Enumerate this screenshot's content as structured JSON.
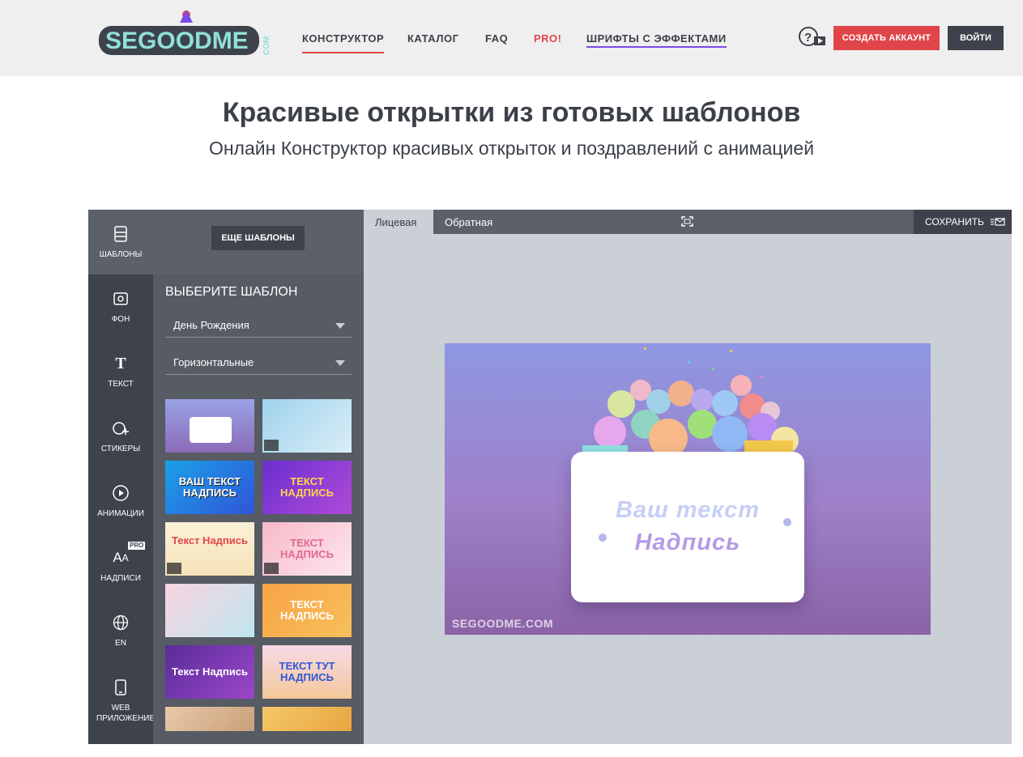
{
  "header": {
    "logo_text": "SEGOODME",
    "logo_suffix": "COM",
    "nav": [
      {
        "label": "КОНСТРУКТОР"
      },
      {
        "label": "КАТАЛОГ"
      },
      {
        "label": "FAQ"
      },
      {
        "label": "PRO!"
      },
      {
        "label": "ШРИФТЫ С ЭФФЕКТАМИ"
      }
    ],
    "help_icon": "help-video-icon",
    "create_account": "СОЗДАТЬ АККАУНТ",
    "login": "ВОЙТИ"
  },
  "hero": {
    "title": "Красивые открытки из готовых шаблонов",
    "subtitle": "Онлайн Конструктор красивых открыток и поздравлений с анимацией"
  },
  "toolbar": {
    "items": [
      {
        "label": "ШАБЛОНЫ",
        "icon": "templates-icon",
        "active": true
      },
      {
        "label": "ФОН",
        "icon": "background-icon"
      },
      {
        "label": "ТЕКСТ",
        "icon": "text-icon"
      },
      {
        "label": "СТИКЕРЫ",
        "icon": "sticker-icon"
      },
      {
        "label": "АНИМАЦИИ",
        "icon": "play-icon"
      },
      {
        "label": "НАДПИСИ",
        "icon": "font-icon",
        "badge": "PRO"
      },
      {
        "label": "EN",
        "icon": "globe-icon"
      },
      {
        "label": "WEB ПРИЛОЖЕНИЕ",
        "icon": "phone-icon"
      }
    ]
  },
  "panel": {
    "more_templates": "ЕЩЕ ШАБЛОНЫ",
    "heading": "ВЫБЕРИТЕ ШАБЛОН",
    "category": "День Рождения",
    "orientation": "Горизонтальные",
    "thumbs": [
      {
        "text": ""
      },
      {
        "text": ""
      },
      {
        "text": "ВАШ ТЕКСТ НАДПИСЬ"
      },
      {
        "text": "ТЕКСТ НАДПИСЬ"
      },
      {
        "text": "Текст Надпись"
      },
      {
        "text": "ТЕКСТ НАДПИСЬ"
      },
      {
        "text": ""
      },
      {
        "text": "ТЕКСТ НАДПИСЬ"
      },
      {
        "text": "Текст Надпись"
      },
      {
        "text": "ТЕКСТ ТУТ НАДПИСЬ"
      },
      {
        "text": ""
      },
      {
        "text": ""
      }
    ]
  },
  "canvas": {
    "tab_front": "Лицевая",
    "tab_back": "Обратная",
    "save": "СОХРАНИТЬ",
    "card_line1": "Ваш текст",
    "card_line2": "Надпись",
    "watermark": "SEGOODME.COM"
  },
  "colors": {
    "accent": "#e0454a",
    "dark": "#3d424b",
    "panel": "#565b64",
    "fonts_underline": "#7a4be6"
  }
}
